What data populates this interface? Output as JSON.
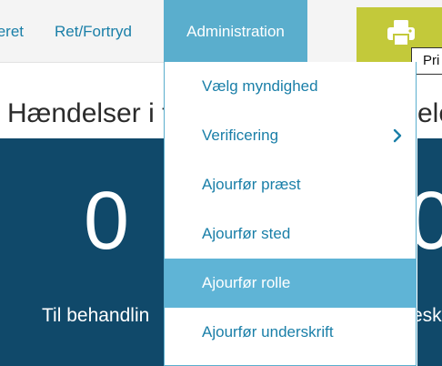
{
  "topbar": {
    "items": [
      {
        "label": "eret"
      },
      {
        "label": "Ret/Fortryd"
      },
      {
        "label": "Administration"
      }
    ],
    "print_tooltip": "Pri"
  },
  "page": {
    "heading": "Hændelser i t",
    "heading_right": "ele"
  },
  "tiles": [
    {
      "value": "0",
      "label": "Til behandlin"
    },
    {
      "value": "0",
      "label": "esk"
    }
  ],
  "admin_menu": {
    "items": [
      {
        "label": "Vælg myndighed"
      },
      {
        "label": "Verificering",
        "submenu_icon": "chevron-right-icon"
      },
      {
        "label": "Ajourfør præst"
      },
      {
        "label": "Ajourfør sted"
      },
      {
        "label": "Ajourfør rolle",
        "state": "highlighted"
      },
      {
        "label": "Ajourfør underskrift"
      }
    ]
  },
  "colors": {
    "link": "#1a7fa8",
    "nav_active": "#5aaecd",
    "menu_hover": "#5fb4d6",
    "print_button": "#c3c93a",
    "tile": "#10496a"
  }
}
